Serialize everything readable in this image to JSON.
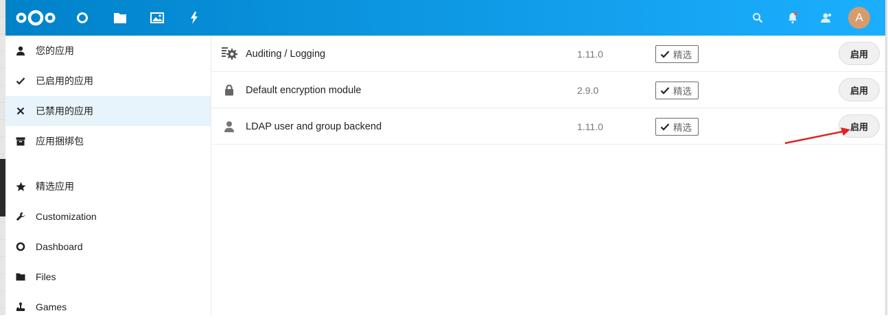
{
  "header": {
    "avatar_letter": "A",
    "accent_gradient": [
      "#0082c9",
      "#1cafff"
    ],
    "apps": [
      {
        "icon": "dashboard-icon"
      },
      {
        "icon": "files-icon"
      },
      {
        "icon": "photos-icon"
      },
      {
        "icon": "activity-icon"
      }
    ],
    "right_icons": [
      "search-icon",
      "notifications-icon",
      "contacts-icon"
    ]
  },
  "sidebar": {
    "items": [
      {
        "label": "您的应用",
        "icon": "user-icon"
      },
      {
        "label": "已启用的应用",
        "icon": "check-icon"
      },
      {
        "label": "已禁用的应用",
        "icon": "close-icon",
        "active": true
      },
      {
        "label": "应用捆绑包",
        "icon": "archive-icon"
      },
      {
        "label": "精选应用",
        "icon": "star-icon"
      },
      {
        "label": "Customization",
        "icon": "wrench-icon"
      },
      {
        "label": "Dashboard",
        "icon": "circle-icon"
      },
      {
        "label": "Files",
        "icon": "folder-icon"
      },
      {
        "label": "Games",
        "icon": "joystick-icon"
      }
    ]
  },
  "apps": [
    {
      "name": "Auditing / Logging",
      "version": "1.11.0",
      "featured_label": "精选",
      "enable_label": "启用",
      "icon": "auditing-icon"
    },
    {
      "name": "Default encryption module",
      "version": "2.9.0",
      "featured_label": "精选",
      "enable_label": "启用",
      "icon": "lock-icon"
    },
    {
      "name": "LDAP user and group backend",
      "version": "1.11.0",
      "featured_label": "精选",
      "enable_label": "启用",
      "icon": "user-icon"
    }
  ],
  "annotation": {
    "color": "#e02424"
  }
}
